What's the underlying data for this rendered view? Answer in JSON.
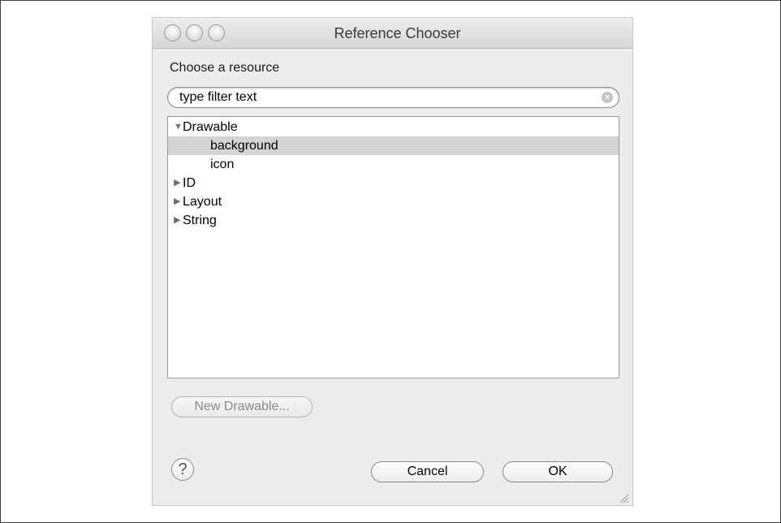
{
  "dialog": {
    "title": "Reference Chooser",
    "section_label": "Choose a resource",
    "filter": {
      "placeholder": "type filter text",
      "value": ""
    },
    "tree": [
      {
        "label": "Drawable",
        "expanded": true,
        "level": 0,
        "selected": false,
        "disclosure": "▼"
      },
      {
        "label": "background",
        "level": 2,
        "selected": true
      },
      {
        "label": "icon",
        "level": 2,
        "selected": false
      },
      {
        "label": "ID",
        "expanded": false,
        "level": 0,
        "selected": false,
        "disclosure": "▶"
      },
      {
        "label": "Layout",
        "expanded": false,
        "level": 0,
        "selected": false,
        "disclosure": "▶"
      },
      {
        "label": "String",
        "expanded": false,
        "level": 0,
        "selected": false,
        "disclosure": "▶"
      }
    ],
    "new_button": {
      "label": "New Drawable...",
      "enabled": false
    },
    "cancel_label": "Cancel",
    "ok_label": "OK",
    "help_icon": "question-mark-icon",
    "help_glyph": "?",
    "clear_glyph": "×"
  }
}
